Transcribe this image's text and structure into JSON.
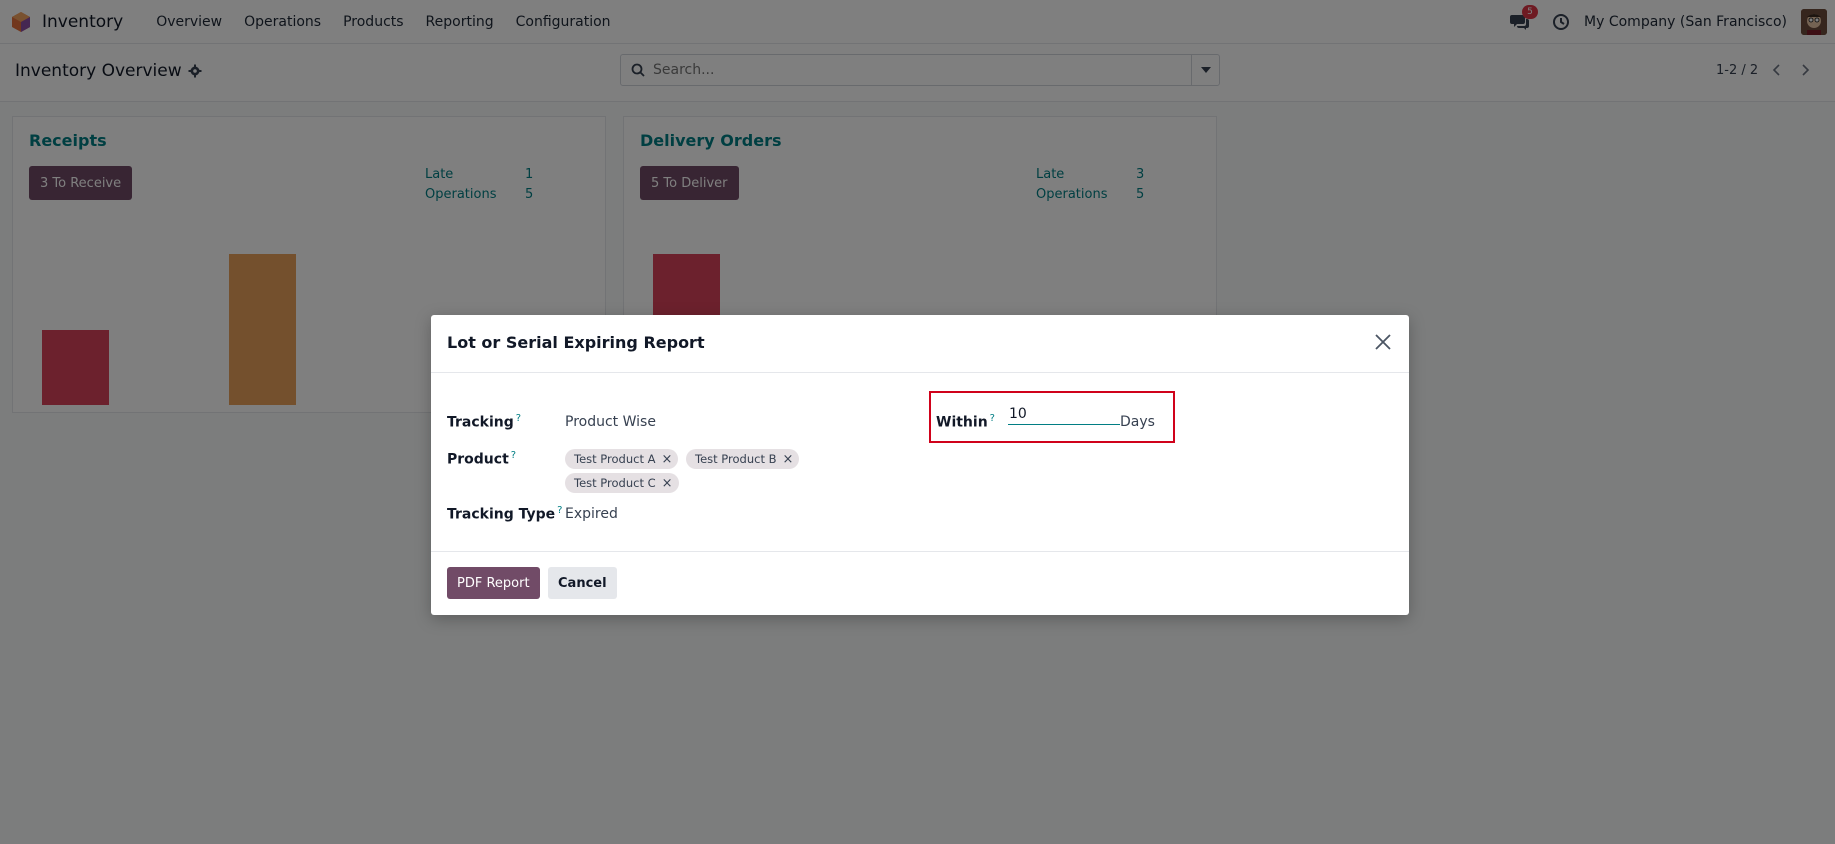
{
  "navbar": {
    "app_name": "Inventory",
    "menu": [
      "Overview",
      "Operations",
      "Products",
      "Reporting",
      "Configuration"
    ],
    "chat_count": "5",
    "company": "My Company (San Francisco)"
  },
  "control_panel": {
    "title": "Inventory Overview",
    "search_placeholder": "Search...",
    "pager": "1-2 / 2"
  },
  "cards": [
    {
      "title": "Receipts",
      "button": "3 To Receive",
      "stats": [
        {
          "label": "Late",
          "value": "1"
        },
        {
          "label": "Operations",
          "value": "5"
        }
      ]
    },
    {
      "title": "Delivery Orders",
      "button": "5 To Deliver",
      "stats": [
        {
          "label": "Late",
          "value": "3"
        },
        {
          "label": "Operations",
          "value": "5"
        }
      ]
    }
  ],
  "modal": {
    "title": "Lot or Serial Expiring Report",
    "tracking_label": "Tracking",
    "tracking_value": "Product Wise",
    "product_label": "Product",
    "products": [
      "Test Product A",
      "Test Product B",
      "Test Product C"
    ],
    "tracking_type_label": "Tracking Type",
    "tracking_type_value": "Expired",
    "within_label": "Within",
    "within_value": "10",
    "within_unit": "Days",
    "help_mark": "?",
    "tag_remove": "×",
    "pdf_button": "PDF Report",
    "cancel_button": "Cancel"
  },
  "colors": {
    "brand": "#714b67",
    "teal": "#017e84",
    "bar_red": "#d9435a",
    "bar_orange": "#e8a15b",
    "highlight": "#d0021b"
  }
}
